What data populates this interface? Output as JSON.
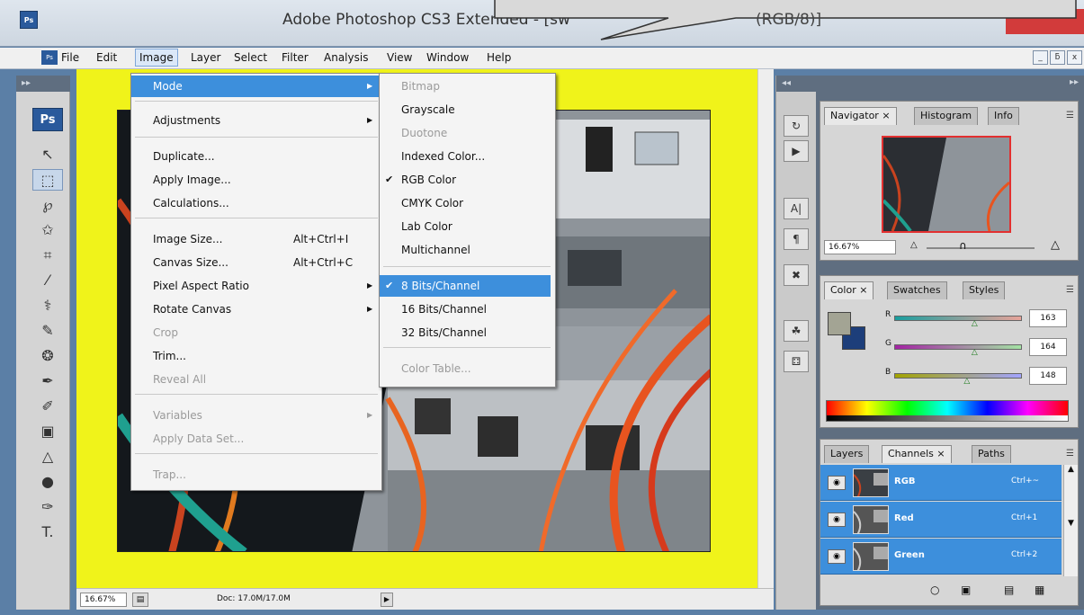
{
  "window": {
    "app_icon": "Ps",
    "title": "Adobe Photoshop CS3 Extended - [sw",
    "title_tail": "(RGB/8)]"
  },
  "menubar": {
    "icon": "Ps",
    "items": [
      "File",
      "Edit",
      "Image",
      "Layer",
      "Select",
      "Filter",
      "Analysis",
      "View",
      "Window",
      "Help"
    ],
    "active": "Image",
    "controls": [
      "_",
      "ƃ",
      "x"
    ]
  },
  "toolbox": {
    "logo": "Ps",
    "header": "▸▸",
    "tools": [
      {
        "icon": "move-tool-icon",
        "glyph": "↖"
      },
      {
        "icon": "marquee-tool-icon",
        "glyph": "⬚"
      },
      {
        "icon": "lasso-tool-icon",
        "glyph": "℘"
      },
      {
        "icon": "magic-wand-tool-icon",
        "glyph": "✩"
      },
      {
        "icon": "crop-tool-icon",
        "glyph": "⌗"
      },
      {
        "icon": "slice-tool-icon",
        "glyph": "⁄"
      },
      {
        "icon": "healing-brush-tool-icon",
        "glyph": "⚕"
      },
      {
        "icon": "brush-tool-icon",
        "glyph": "✎"
      },
      {
        "icon": "clone-stamp-tool-icon",
        "glyph": "❂"
      },
      {
        "icon": "history-brush-tool-icon",
        "glyph": "✒"
      },
      {
        "icon": "eraser-tool-icon",
        "glyph": "✐"
      },
      {
        "icon": "gradient-tool-icon",
        "glyph": "▣"
      },
      {
        "icon": "blur-tool-icon",
        "glyph": "△"
      },
      {
        "icon": "dodge-tool-icon",
        "glyph": "●"
      },
      {
        "icon": "pen-tool-icon",
        "glyph": "✑"
      },
      {
        "icon": "type-tool-icon",
        "glyph": "T."
      }
    ]
  },
  "image_menu": {
    "items": [
      {
        "label": "Mode",
        "shortcut": "",
        "submenu": true,
        "disabled": false,
        "highlight": true
      },
      {
        "label": "Adjustments",
        "shortcut": "",
        "submenu": true,
        "disabled": false,
        "highlight": false
      },
      {
        "label": "Duplicate...",
        "shortcut": "",
        "submenu": false,
        "disabled": false,
        "highlight": false
      },
      {
        "label": "Apply Image...",
        "shortcut": "",
        "submenu": false,
        "disabled": false,
        "highlight": false
      },
      {
        "label": "Calculations...",
        "shortcut": "",
        "submenu": false,
        "disabled": false,
        "highlight": false
      },
      {
        "label": "Image Size...",
        "shortcut": "Alt+Ctrl+I",
        "submenu": false,
        "disabled": false,
        "highlight": false
      },
      {
        "label": "Canvas Size...",
        "shortcut": "Alt+Ctrl+C",
        "submenu": false,
        "disabled": false,
        "highlight": false
      },
      {
        "label": "Pixel Aspect Ratio",
        "shortcut": "",
        "submenu": true,
        "disabled": false,
        "highlight": false
      },
      {
        "label": "Rotate Canvas",
        "shortcut": "",
        "submenu": true,
        "disabled": false,
        "highlight": false
      },
      {
        "label": "Crop",
        "shortcut": "",
        "submenu": false,
        "disabled": true,
        "highlight": false
      },
      {
        "label": "Trim...",
        "shortcut": "",
        "submenu": false,
        "disabled": false,
        "highlight": false
      },
      {
        "label": "Reveal All",
        "shortcut": "",
        "submenu": false,
        "disabled": true,
        "highlight": false
      },
      {
        "label": "Variables",
        "shortcut": "",
        "submenu": true,
        "disabled": true,
        "highlight": false
      },
      {
        "label": "Apply Data Set...",
        "shortcut": "",
        "submenu": false,
        "disabled": true,
        "highlight": false
      },
      {
        "label": "Trap...",
        "shortcut": "",
        "submenu": false,
        "disabled": true,
        "highlight": false
      }
    ]
  },
  "mode_menu": {
    "items": [
      {
        "label": "Bitmap",
        "checked": false,
        "disabled": true,
        "highlight": false
      },
      {
        "label": "Grayscale",
        "checked": false,
        "disabled": false,
        "highlight": false
      },
      {
        "label": "Duotone",
        "checked": false,
        "disabled": true,
        "highlight": false
      },
      {
        "label": "Indexed Color...",
        "checked": false,
        "disabled": false,
        "highlight": false
      },
      {
        "label": "RGB Color",
        "checked": true,
        "disabled": false,
        "highlight": false
      },
      {
        "label": "CMYK Color",
        "checked": false,
        "disabled": false,
        "highlight": false
      },
      {
        "label": "Lab Color",
        "checked": false,
        "disabled": false,
        "highlight": false
      },
      {
        "label": "Multichannel",
        "checked": false,
        "disabled": false,
        "highlight": false
      },
      {
        "label": "8 Bits/Channel",
        "checked": true,
        "disabled": false,
        "highlight": true
      },
      {
        "label": "16 Bits/Channel",
        "checked": false,
        "disabled": false,
        "highlight": false
      },
      {
        "label": "32 Bits/Channel",
        "checked": false,
        "disabled": false,
        "highlight": false
      },
      {
        "label": "Color Table...",
        "checked": false,
        "disabled": true,
        "highlight": false
      }
    ]
  },
  "statusbar": {
    "zoom": "16.67%",
    "doc": "Doc: 17.0M/17.0M"
  },
  "dock": {
    "header": "◂◂",
    "buttons": [
      {
        "icon": "history-icon",
        "glyph": "↻"
      },
      {
        "icon": "actions-icon",
        "glyph": "▶"
      },
      {
        "icon": "character-icon",
        "glyph": "A|"
      },
      {
        "icon": "paragraph-icon",
        "glyph": "¶"
      },
      {
        "icon": "tool-presets-icon",
        "glyph": "✖"
      },
      {
        "icon": "brushes-icon",
        "glyph": "☘"
      },
      {
        "icon": "clone-source-icon",
        "glyph": "⚃"
      }
    ]
  },
  "panels": {
    "header": "▸▸",
    "navigator": {
      "tabs": [
        "Navigator",
        "Histogram",
        "Info"
      ],
      "zoom": "16.67%"
    },
    "color": {
      "tabs": [
        "Color",
        "Swatches",
        "Styles"
      ],
      "channels": [
        {
          "label": "R",
          "value": 163,
          "fraction": 0.64,
          "gradient": [
            "#1a9e9e",
            "#e8a39a"
          ]
        },
        {
          "label": "G",
          "value": 164,
          "fraction": 0.64,
          "gradient": [
            "#a323a3",
            "#a3e3a3"
          ]
        },
        {
          "label": "B",
          "value": 148,
          "fraction": 0.58,
          "gradient": [
            "#a3a400",
            "#a3a4ff"
          ]
        }
      ],
      "fg_color": "#a3a494",
      "bg_color": "#1d3e7a"
    },
    "channels_panel": {
      "tabs": [
        "Layers",
        "Channels",
        "Paths"
      ],
      "rows": [
        {
          "name": "RGB",
          "shortcut": "Ctrl+~"
        },
        {
          "name": "Red",
          "shortcut": "Ctrl+1"
        },
        {
          "name": "Green",
          "shortcut": "Ctrl+2"
        }
      ]
    }
  },
  "colors": {
    "canvas_bg": "#f0f31a",
    "highlight": "#3d8fdc"
  }
}
